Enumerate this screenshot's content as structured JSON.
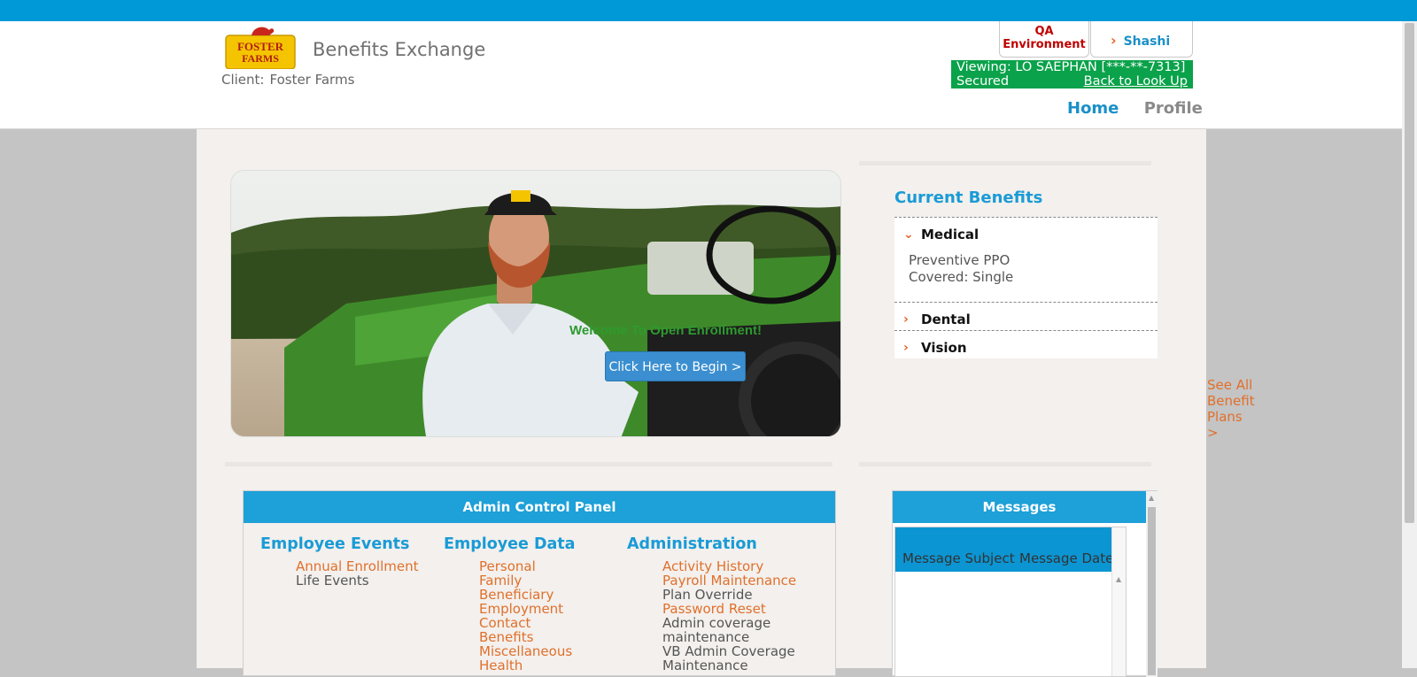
{
  "header": {
    "logo_text": [
      "FOSTER",
      "FARMS"
    ],
    "app_title": "Benefits Exchange",
    "client_label": "Client:",
    "client_name": "Foster Farms",
    "environment": [
      "QA",
      "Environment"
    ],
    "user_name": "Shashi",
    "viewing_text": "Viewing: LO SAEPHAN [***-**-7313]",
    "secured_text": "Secured",
    "back_link": "Back to Look Up",
    "nav": {
      "home": "Home",
      "profile": "Profile"
    }
  },
  "hero": {
    "welcome": "Welcome To Open Enrollment!",
    "button": "Click Here to Begin >"
  },
  "current_benefits": {
    "title": "Current Benefits",
    "items": [
      {
        "label": "Medical",
        "expanded": true,
        "plan": "Preventive PPO",
        "coverage": "Covered: Single"
      },
      {
        "label": "Dental",
        "expanded": false
      },
      {
        "label": "Vision",
        "expanded": false
      }
    ],
    "see_all": "See All Benefit Plans >"
  },
  "admin_panel": {
    "title": "Admin Control Panel",
    "columns": [
      {
        "heading": "Employee Events",
        "items": [
          {
            "label": "Annual Enrollment",
            "link": true
          },
          {
            "label": "Life Events",
            "link": false
          }
        ]
      },
      {
        "heading": "Employee Data",
        "items": [
          {
            "label": "Personal",
            "link": true
          },
          {
            "label": "Family",
            "link": true
          },
          {
            "label": "Beneficiary",
            "link": true
          },
          {
            "label": "Employment",
            "link": true
          },
          {
            "label": "Contact",
            "link": true
          },
          {
            "label": "Benefits",
            "link": true
          },
          {
            "label": "Miscellaneous",
            "link": true
          },
          {
            "label": "Health",
            "link": true
          }
        ]
      },
      {
        "heading": "Administration",
        "items": [
          {
            "label": "Activity History",
            "link": true
          },
          {
            "label": "Payroll Maintenance",
            "link": true
          },
          {
            "label": "Plan Override",
            "link": false
          },
          {
            "label": "Password Reset",
            "link": true
          },
          {
            "label": "Admin coverage maintenance",
            "link": false
          },
          {
            "label": "VB Admin Coverage Maintenance",
            "link": false
          }
        ]
      }
    ]
  },
  "messages": {
    "title": "Messages",
    "columns": [
      "Message Subject",
      "Message Date"
    ]
  },
  "colors": {
    "brand_blue": "#0099d8",
    "accent_orange": "#e0702c",
    "secured_green": "#0aa24a",
    "qa_red": "#c00000"
  }
}
